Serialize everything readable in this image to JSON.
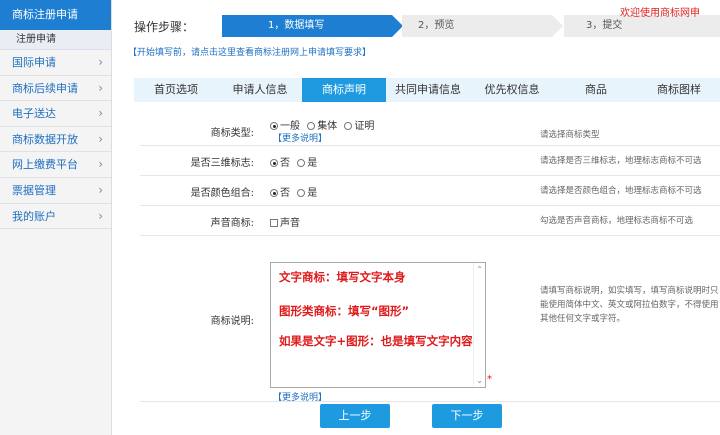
{
  "sidebar": {
    "header": "商标注册申请",
    "sub_item": "注册申请",
    "items": [
      {
        "label": "国际申请"
      },
      {
        "label": "商标后续申请"
      },
      {
        "label": "电子送达"
      },
      {
        "label": "商标数据开放"
      },
      {
        "label": "网上缴费平台"
      },
      {
        "label": "票据管理"
      },
      {
        "label": "我的账户"
      }
    ],
    "chevron": "›"
  },
  "header": {
    "steps_label": "操作步骤：",
    "steps": [
      {
        "label": "1，数据填写"
      },
      {
        "label": "2，预览"
      },
      {
        "label": "3，提交"
      }
    ],
    "welcome": "欢迎使用商标网申",
    "notice": "【开始填写前，请点击这里查看商标注册网上申请填写要求】"
  },
  "tabs": [
    {
      "label": "首页选项"
    },
    {
      "label": "申请人信息"
    },
    {
      "label": "商标声明"
    },
    {
      "label": "共同申请信息"
    },
    {
      "label": "优先权信息"
    },
    {
      "label": "商品"
    },
    {
      "label": "商标图样"
    }
  ],
  "form": {
    "type": {
      "label": "商标类型:",
      "options": [
        "一般",
        "集体",
        "证明"
      ],
      "selected": "一般",
      "more": "【更多说明】",
      "hint": "请选择商标类型"
    },
    "three_d": {
      "label": "是否三维标志:",
      "options": [
        "否",
        "是"
      ],
      "selected": "否",
      "hint": "请选择是否三维标志，地理标志商标不可选"
    },
    "color": {
      "label": "是否颜色组合:",
      "options": [
        "否",
        "是"
      ],
      "selected": "否",
      "hint": "请选择是否颜色组合，地理标志商标不可选"
    },
    "sound": {
      "label": "声音商标:",
      "checkbox_label": "声音",
      "checked": false,
      "hint": "勾选是否声音商标，地理标志商标不可选"
    },
    "description": {
      "label": "商标说明:",
      "lines": [
        "文字商标：填写文字本身",
        "图形类商标：填写“图形”",
        "如果是文字+图形：也是填写文字内容"
      ],
      "required_mark": "*",
      "more": "【更多说明】",
      "hint": "请填写商标说明，如实填写，填写商标说明时只能使用简体中文、英文或阿拉伯数字，不得使用其他任何文字或字符。"
    }
  },
  "buttons": {
    "prev": "上一步",
    "next": "下一步"
  },
  "colors": {
    "primary": "#1e7fd2",
    "tab_active": "#1e9be0",
    "link": "#1e6fc2",
    "warning": "#e01a1a"
  }
}
